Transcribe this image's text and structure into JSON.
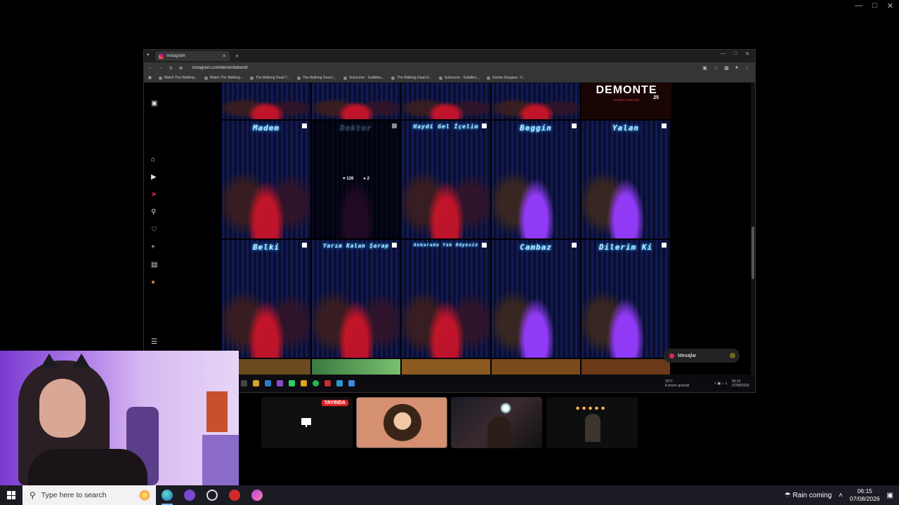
{
  "browser": {
    "tab_title": "Instagram",
    "url": "instagram.com/demonteband/",
    "bookmarks": [
      "Watch The Walking...",
      "Watch The Walking...",
      "The Walking Dead T...",
      "The Walking Dead (...",
      "Subscene - Subtitles...",
      "The Walking Dead E...",
      "Subscene - Subtitles...",
      "Zaman Durgaza - F..."
    ]
  },
  "instagram": {
    "poster_title": "DEMONTE",
    "poster_subtitle": "FIRARLI KOMPOZE",
    "poster_number": "25",
    "tiles_row1": [
      "Madem",
      "Doktor",
      "Haydi Gel İçelim",
      "Beggin",
      "Yalan"
    ],
    "tiles_row2": [
      "Belki",
      "Yarım Kalan Şarap",
      "Ankarada Yok Döyesin",
      "Cambaz",
      "Dilerim Ki"
    ],
    "hover_likes": "126",
    "hover_comments": "2",
    "messages_label": "Mesajlar"
  },
  "inner_taskbar": {
    "weather": "29°C",
    "weather_sub": "Kısmen güneşli",
    "time": "06:15",
    "date": "07/08/2026"
  },
  "participants": {
    "live_badge": "YAYINDA"
  },
  "taskbar": {
    "search_placeholder": "Type here to search",
    "weather": "Rain coming",
    "time": "06:15",
    "date": "07/08/2026"
  }
}
